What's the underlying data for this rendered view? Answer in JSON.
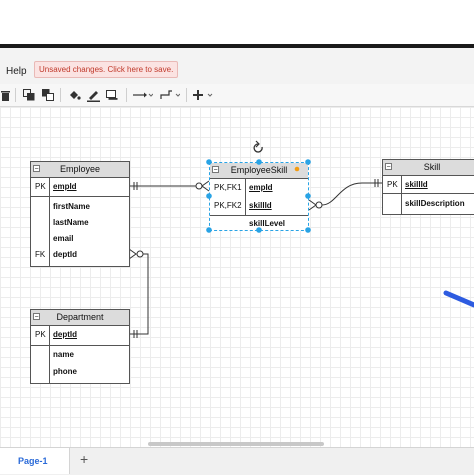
{
  "menu": {
    "help": "Help",
    "unsaved": "Unsaved changes. Click here to save."
  },
  "colors": {
    "accent": "#2a6ad8",
    "selection": "#29a3e5",
    "warning": "#c0392b"
  },
  "toolbar": {
    "icons": [
      "delete-icon",
      "to-front-icon",
      "to-back-icon",
      "fill-color-icon",
      "line-color-icon",
      "shadow-icon",
      "connection-icon",
      "waypoints-icon",
      "insert-icon"
    ]
  },
  "entities": {
    "employee": {
      "title": "Employee",
      "rows": [
        {
          "key": "PK",
          "name": "empId",
          "underline": true
        },
        {
          "key": "",
          "name": "firstName",
          "underline": false
        },
        {
          "key": "",
          "name": "lastName",
          "underline": false
        },
        {
          "key": "",
          "name": "email",
          "underline": false
        },
        {
          "key": "FK",
          "name": "deptId",
          "underline": false
        }
      ]
    },
    "employeeskill": {
      "title": "EmployeeSkill",
      "rows": [
        {
          "key": "PK,FK1",
          "name": "empId",
          "underline": true
        },
        {
          "key": "PK,FK2",
          "name": "skillId",
          "underline": true
        },
        {
          "key": "",
          "name": "skillLevel",
          "underline": false
        }
      ]
    },
    "skill": {
      "title": "Skill",
      "rows": [
        {
          "key": "PK",
          "name": "skillId",
          "underline": true
        },
        {
          "key": "",
          "name": "skillDescription",
          "underline": false
        }
      ]
    },
    "department": {
      "title": "Department",
      "rows": [
        {
          "key": "PK",
          "name": "deptId",
          "underline": true
        },
        {
          "key": "",
          "name": "name",
          "underline": false
        },
        {
          "key": "",
          "name": "phone",
          "underline": false
        }
      ]
    }
  },
  "pages": {
    "current": "Page-1",
    "add": "+"
  }
}
